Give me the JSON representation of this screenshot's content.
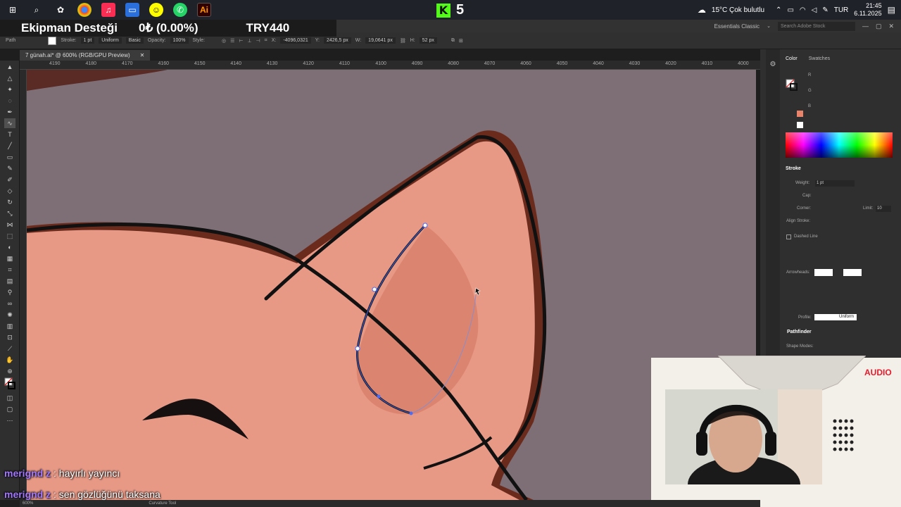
{
  "overlay": {
    "title": "Ekipman Desteği",
    "amount": "0₺ (0.00%)",
    "goal": "TRY440"
  },
  "taskbar": {
    "kick_count": "5",
    "weather": "15°C  Çok bulutlu",
    "language": "TUR",
    "time": "21:45",
    "date": "6.11.2025"
  },
  "illustrator": {
    "workspace": "Essentials Classic",
    "stock_search_placeholder": "Search Adobe Stock",
    "doc_tab": "7 günah.ai* @ 600% (RGB/GPU Preview)",
    "control": {
      "path_label": "Path",
      "stroke_label": "Stroke:",
      "stroke_weight": "1 pt",
      "uniform": "Uniform",
      "basic": "Basic",
      "opacity_label": "Opacity:",
      "opacity": "100%",
      "style_label": "Style:",
      "x": "-4096,0321",
      "y": "2426,5 px",
      "w": "19,0641 px",
      "h": "52 px"
    },
    "ruler_ticks": [
      "4190",
      "4180",
      "4170",
      "4160",
      "4150",
      "4140",
      "4130",
      "4120",
      "4110",
      "4100",
      "4090",
      "4080",
      "4070",
      "4060",
      "4050",
      "4040",
      "4030",
      "4020",
      "4010",
      "4000"
    ],
    "panels": {
      "color_tab": "Color",
      "swatches_tab": "Swatches",
      "channels": [
        "R",
        "G",
        "B"
      ],
      "stroke_header": "Stroke",
      "weight_label": "Weight:",
      "weight_value": "1 pt",
      "cap_label": "Cap:",
      "corner_label": "Corner:",
      "limit_label": "Limit:",
      "limit_value": "10",
      "align_label": "Align Stroke:",
      "dashed_label": "Dashed Line",
      "arrowheads_label": "Arrowheads:",
      "profile_label": "Profile:",
      "profile_value": "Uniform",
      "pathfinder_header": "Pathfinder",
      "shape_modes": "Shape Modes:"
    },
    "status": {
      "zoom": "600%",
      "tool": "Curvature Tool"
    }
  },
  "webcam": {
    "audio_label": "AUDIO"
  },
  "chat": [
    {
      "user": "merignd z",
      "message": ": hayırlı yayıncı"
    },
    {
      "user": "merignd z",
      "message": ": sen gözlüğünü taksana"
    }
  ]
}
